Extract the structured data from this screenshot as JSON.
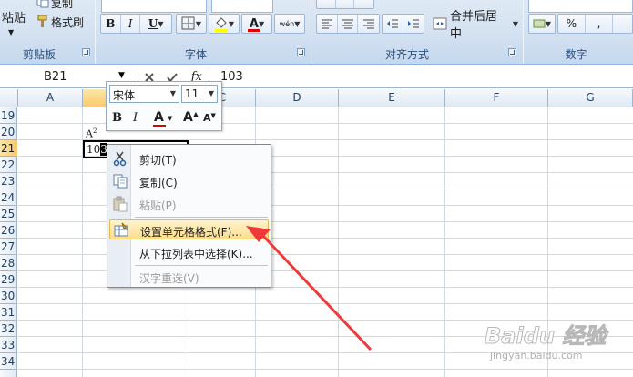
{
  "ribbon": {
    "clipboard": {
      "group_label": "剪贴板",
      "paste_label": "粘贴",
      "copy_label": "复制",
      "format_painter_label": "格式刷"
    },
    "font": {
      "group_label": "字体",
      "bold": "B",
      "italic": "I",
      "underline": "U",
      "font_color_letter": "A",
      "pinyin_label": "wén"
    },
    "alignment": {
      "group_label": "对齐方式",
      "merge_center_label": "合并后居中"
    },
    "number": {
      "group_label": "数字",
      "percent": "%",
      "comma": ","
    }
  },
  "formula_bar": {
    "name_box": "B21",
    "fx_label": "fx",
    "value": "103"
  },
  "grid": {
    "columns": [
      "A",
      "B",
      "C",
      "D",
      "E",
      "F",
      "G"
    ],
    "active_column": "B",
    "rows": [
      "19",
      "20",
      "21",
      "22",
      "23",
      "24",
      "25",
      "26",
      "27",
      "28",
      "29",
      "30",
      "31",
      "32",
      "33",
      "34"
    ],
    "active_row": "21",
    "cell_b20": {
      "base": "A",
      "superscript": "2"
    },
    "cell_b21": {
      "prefix": "10",
      "selected": "3"
    }
  },
  "mini_toolbar": {
    "font_name": "宋体",
    "font_size": "11",
    "bold": "B",
    "italic": "I",
    "font_color_letter": "A",
    "grow_font": "A",
    "shrink_font": "A"
  },
  "context_menu": {
    "items": [
      {
        "label": "剪切(T)",
        "icon": "scissors-icon",
        "enabled": true
      },
      {
        "label": "复制(C)",
        "icon": "copy-icon",
        "enabled": true
      },
      {
        "label": "粘贴(P)",
        "icon": "paste-icon",
        "enabled": false
      },
      {
        "label": "设置单元格格式(F)...",
        "icon": "format-cells-icon",
        "enabled": true,
        "highlighted": true
      },
      {
        "label": "从下拉列表中选择(K)...",
        "icon": "",
        "enabled": true
      },
      {
        "label": "汉字重选(V)",
        "icon": "",
        "enabled": false
      }
    ]
  },
  "watermark": {
    "text": "Baidu 经验",
    "url": "jingyan.baidu.com"
  },
  "colors": {
    "arrow": "#f03a3a",
    "highlight": "#fedd8b",
    "font_color_red": "#e00000",
    "ribbon_blue": "#d3e1f1"
  }
}
